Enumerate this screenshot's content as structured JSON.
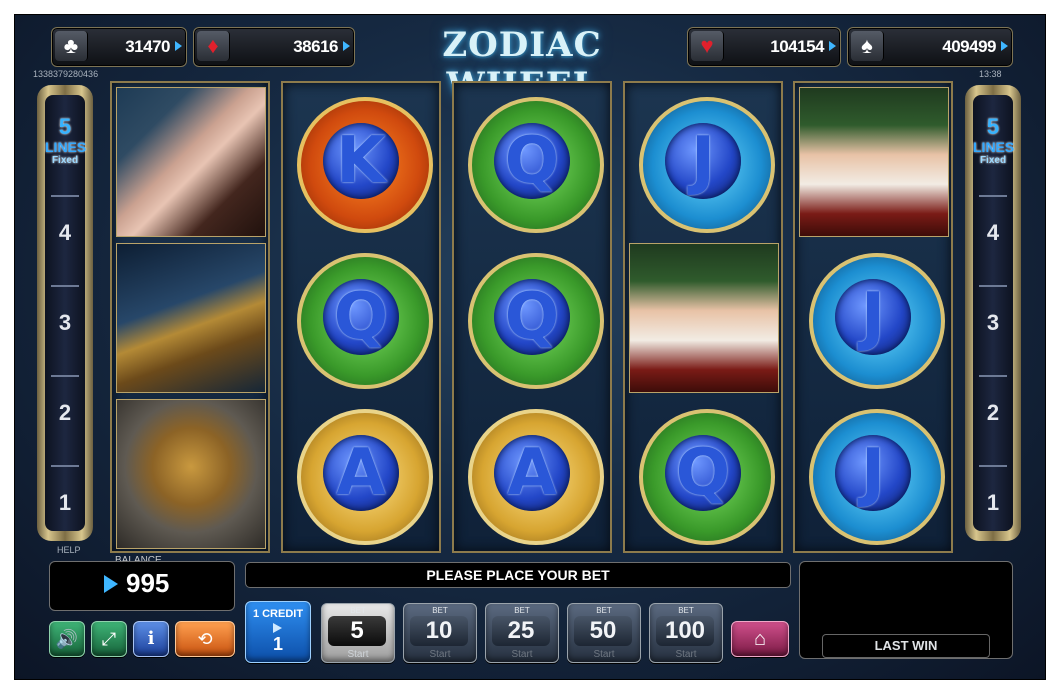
{
  "game": {
    "title": "ZODIAC WHEEL"
  },
  "jackpots": {
    "clubs": {
      "icon": "clubs-icon",
      "value": "31470"
    },
    "diamonds": {
      "icon": "diamonds-icon",
      "value": "38616"
    },
    "hearts": {
      "icon": "hearts-icon",
      "value": "104154"
    },
    "spades": {
      "icon": "spades-icon",
      "value": "409499"
    }
  },
  "session_id": "1338379280436",
  "clock": "13:38",
  "help": "HELP",
  "lines": {
    "count": "5",
    "label": "LINES",
    "mode": "Fixed",
    "numbers": [
      "4",
      "3",
      "2",
      "1"
    ]
  },
  "reels": [
    [
      "woman",
      "telescope",
      "armillary-sphere"
    ],
    [
      "K",
      "Q",
      "A"
    ],
    [
      "Q",
      "Q",
      "A"
    ],
    [
      "J",
      "captain",
      "Q"
    ],
    [
      "captain",
      "J",
      "J"
    ]
  ],
  "balance": {
    "label": "BALANCE",
    "value": "995"
  },
  "message": "PLEASE PLACE YOUR BET",
  "credit": {
    "label": "1 CREDIT",
    "value": "1"
  },
  "bets": {
    "label": "BET",
    "start_label": "Start",
    "values": [
      "5",
      "10",
      "25",
      "50",
      "100"
    ],
    "selected": "5"
  },
  "last_win": {
    "label": "LAST WIN",
    "value": ""
  },
  "colors": {
    "accent": "#3fb6ff",
    "frame_gold": "#8d7b4c",
    "background": "#162a43"
  }
}
